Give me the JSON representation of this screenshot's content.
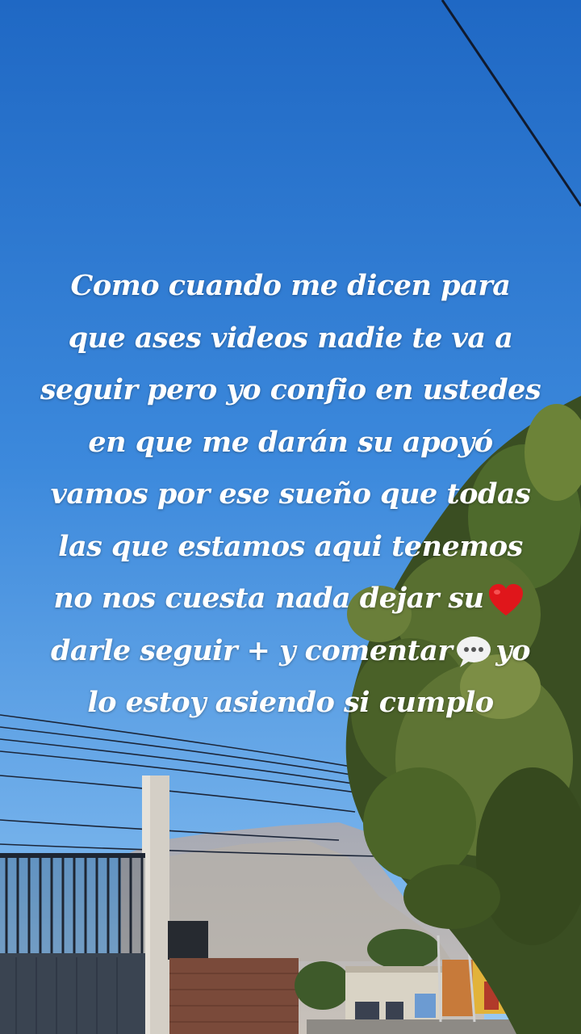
{
  "caption": {
    "lines": [
      "Como cuando me dicen para",
      "que ases videos nadie te va a",
      "seguir pero yo confio en ustedes",
      "en que me darán su apoyó",
      "vamos por ese sueño que  todas",
      "las que estamos aqui tenemos",
      "no nos cuesta nada dejar su",
      "darle seguir + y comentar",
      "yo",
      "lo estoy asiendo si cumplo"
    ],
    "emojis": [
      "red-heart",
      "speech-bubble"
    ]
  },
  "colors": {
    "sky_top": "#1f6bc8",
    "sky_bottom": "#6aa9e8",
    "caption_text": "#ffffff",
    "heart": "#e0161b"
  }
}
